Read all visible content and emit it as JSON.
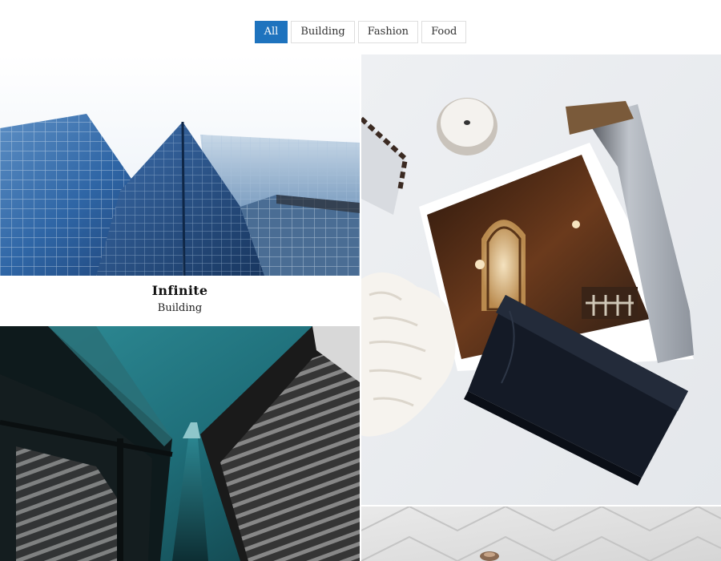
{
  "filters": {
    "all_label": "All",
    "building_label": "Building",
    "fashion_label": "Fashion",
    "food_label": "Food",
    "active": "All"
  },
  "gallery": {
    "items": [
      {
        "title": "Infinite",
        "category": "Building"
      }
    ]
  },
  "colors": {
    "accent": "#1e73be",
    "border": "#dedede"
  }
}
